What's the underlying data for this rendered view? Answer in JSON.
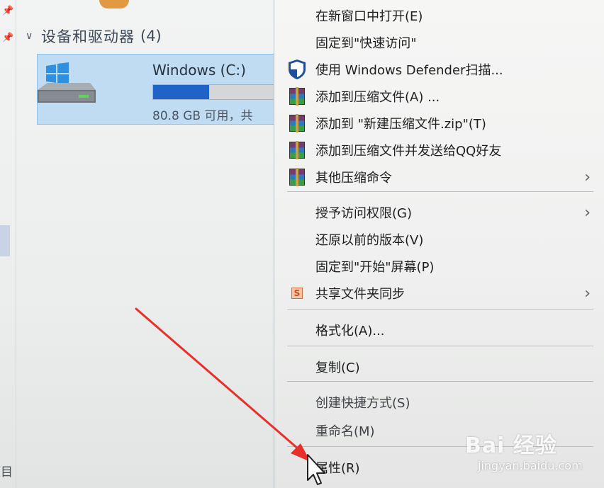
{
  "explorer": {
    "group_title": "设备和驱动器",
    "group_count": "(4)",
    "nav_fragment": "项目",
    "drive": {
      "name": "Windows (C:)",
      "free_text": "80.8 GB 可用，共",
      "usage_fraction": 0.4
    }
  },
  "context_menu": {
    "items": [
      {
        "label": "在新窗口中打开(E)",
        "icon": "none",
        "submenu": false
      },
      {
        "label": "固定到\"快速访问\"",
        "icon": "none",
        "submenu": false
      },
      {
        "label": "使用 Windows Defender扫描...",
        "icon": "defender-shield-icon",
        "submenu": false
      },
      {
        "label": "添加到压缩文件(A) ...",
        "icon": "winrar-icon",
        "submenu": false
      },
      {
        "label": "添加到 \"新建压缩文件.zip\"(T)",
        "icon": "winrar-icon",
        "submenu": false
      },
      {
        "label": "添加到压缩文件并发送给QQ好友",
        "icon": "winrar-icon",
        "submenu": false
      },
      {
        "label": "其他压缩命令",
        "icon": "winrar-icon",
        "submenu": true
      },
      {
        "label": "授予访问权限(G)",
        "icon": "none",
        "submenu": true
      },
      {
        "label": "还原以前的版本(V)",
        "icon": "none",
        "submenu": false
      },
      {
        "label": "固定到\"开始\"屏幕(P)",
        "icon": "none",
        "submenu": false
      },
      {
        "label": "共享文件夹同步",
        "icon": "sync-s-icon",
        "submenu": true
      },
      {
        "label": "格式化(A)...",
        "icon": "none",
        "submenu": false
      },
      {
        "label": "复制(C)",
        "icon": "none",
        "submenu": false
      },
      {
        "label": "创建快捷方式(S)",
        "icon": "none",
        "submenu": false
      },
      {
        "label": "重命名(M)",
        "icon": "none",
        "submenu": false
      },
      {
        "label": "属性(R)",
        "icon": "none",
        "submenu": false
      }
    ],
    "submenu_glyph": "›"
  },
  "watermark": {
    "logo": "Bai 经验",
    "url": "jingyan.baidu.com"
  },
  "colors": {
    "selection_fill": "#bfdcf3",
    "drive_bar_fill": "#1f63c9",
    "annotation_arrow": "#e8302a"
  }
}
